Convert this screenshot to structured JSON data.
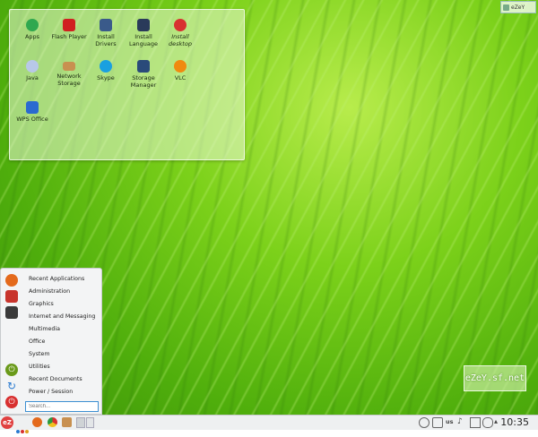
{
  "top_widget": {
    "label": "eZeY"
  },
  "watermark": {
    "text": "eZeY.sf.net"
  },
  "desktop_icons": [
    {
      "label": "Apps",
      "icon": "apps-icon",
      "color": "#2fa84f"
    },
    {
      "label": "Flash Player",
      "icon": "flash-player-icon",
      "color": "#d02020"
    },
    {
      "label": "Install Drivers",
      "icon": "install-drivers-icon",
      "color": "#3a5a8a"
    },
    {
      "label": "Install Language",
      "icon": "install-language-icon",
      "color": "#2a3a5a"
    },
    {
      "label": "Install desktop",
      "icon": "install-desktop-icon",
      "color": "#d83030"
    },
    {
      "label": "Java",
      "icon": "java-icon",
      "color": "#b8c8e8"
    },
    {
      "label": "Network Storage",
      "icon": "network-storage-icon",
      "color": "#c89050"
    },
    {
      "label": "Skype",
      "icon": "skype-icon",
      "color": "#1aa0e0"
    },
    {
      "label": "Storage Manager",
      "icon": "storage-manager-icon",
      "color": "#2a4a7a"
    },
    {
      "label": "VLC",
      "icon": "vlc-icon",
      "color": "#f08a10"
    },
    {
      "label": "WPS Office",
      "icon": "wps-office-icon",
      "color": "#2a6ad0"
    }
  ],
  "menu": {
    "items": [
      "Recent Applications",
      "Administration",
      "Graphics",
      "Internet and Messaging",
      "Multimedia",
      "Office",
      "System",
      "Utilities",
      "Recent Documents",
      "Power / Session"
    ],
    "search_placeholder": "Search..."
  },
  "taskbar": {
    "launcher_label": "eZ",
    "keyboard_layout": "us",
    "clock": "10:35"
  },
  "colors": {
    "accent": "#3d8fd1",
    "launcher": "#e04040",
    "leaf_green": "#6cc414"
  }
}
